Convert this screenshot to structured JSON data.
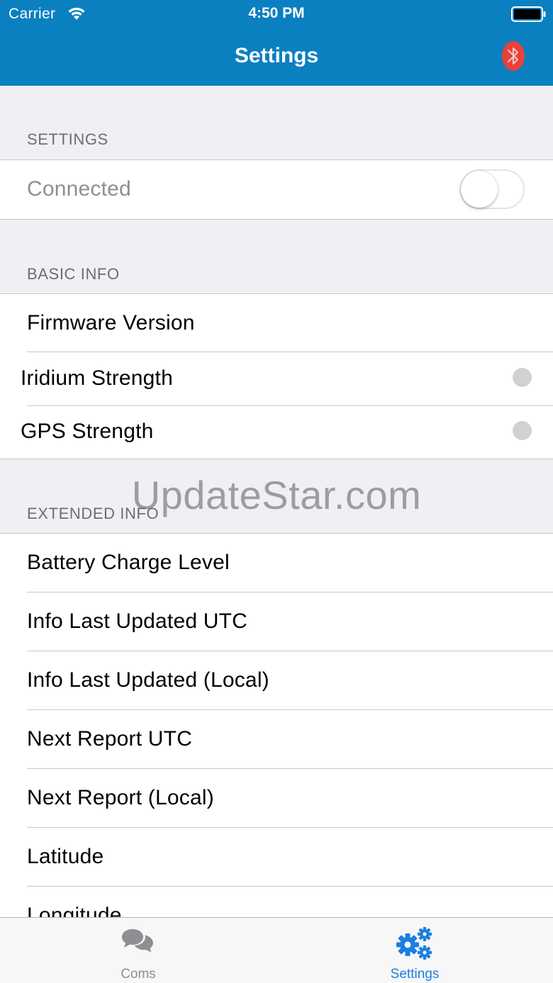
{
  "status_bar": {
    "carrier": "Carrier",
    "time": "4:50 PM"
  },
  "nav": {
    "title": "Settings",
    "bluetooth_icon": "bluetooth-icon",
    "bluetooth_color": "#e8413a"
  },
  "sections": {
    "settings": {
      "header": "SETTINGS",
      "connected_label": "Connected",
      "connected_on": false
    },
    "basic_info": {
      "header": "BASIC INFO",
      "rows": [
        "Firmware Version",
        "Iridium Strength",
        "GPS Strength"
      ]
    },
    "extended_info": {
      "header": "EXTENDED INFO",
      "rows": [
        "Battery Charge Level",
        "Info Last Updated UTC",
        "Info Last Updated (Local)",
        "Next Report UTC",
        "Next Report (Local)",
        "Latitude",
        "Longitude"
      ]
    }
  },
  "watermark": "UpdateStar.com",
  "tabbar": {
    "tabs": [
      {
        "label": "Coms",
        "icon": "chat-bubbles-icon",
        "selected": false
      },
      {
        "label": "Settings",
        "icon": "gears-icon",
        "selected": true
      }
    ],
    "active_color": "#1a7fe0",
    "inactive_color": "#8e8e93"
  },
  "colors": {
    "nav_background": "#0a80c0",
    "indicator_dot": "#d1d1d3"
  }
}
